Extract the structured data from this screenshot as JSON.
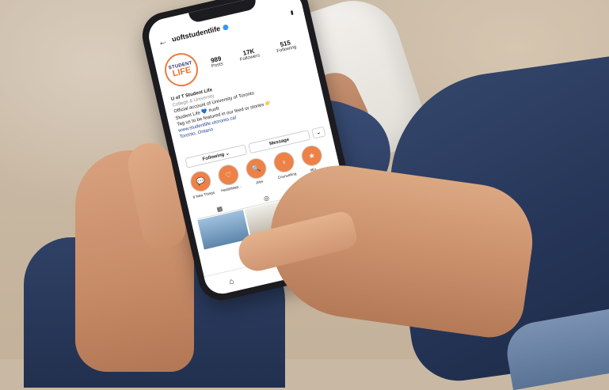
{
  "profile": {
    "username": "uoftstudentlife",
    "avatar_line1": "STUDENT",
    "avatar_line2": "LIFE",
    "stats": [
      {
        "value": "989",
        "label": "Posts"
      },
      {
        "value": "17K",
        "label": "Followers"
      },
      {
        "value": "515",
        "label": "Following"
      }
    ],
    "bio": {
      "name": "U of T Student Life",
      "category": "College & University",
      "line1": "Official account of University of Toronto",
      "line2": "Student Life 💙 #uoft",
      "line3": "Tag us to be featured in our feed or stories 👉",
      "link": "www.studentlife.utoronto.ca/",
      "location": "Toronto, Ontario"
    }
  },
  "buttons": {
    "following": "Following ⌄",
    "message": "Message",
    "more": "⌄"
  },
  "highlights": [
    {
      "label": "8 New Things",
      "icon": "💬"
    },
    {
      "label": "HealthMatt…",
      "icon": "♡"
    },
    {
      "label": "Jobs",
      "icon": "🔍"
    },
    {
      "label": "Counselling",
      "icon": "♀"
    },
    {
      "label": "#Ex…",
      "icon": "★"
    }
  ],
  "colors": {
    "accent": "#ee8146",
    "brand_navy": "#2e2a6b",
    "link": "#1f3e8a",
    "verified": "#3897f0"
  }
}
